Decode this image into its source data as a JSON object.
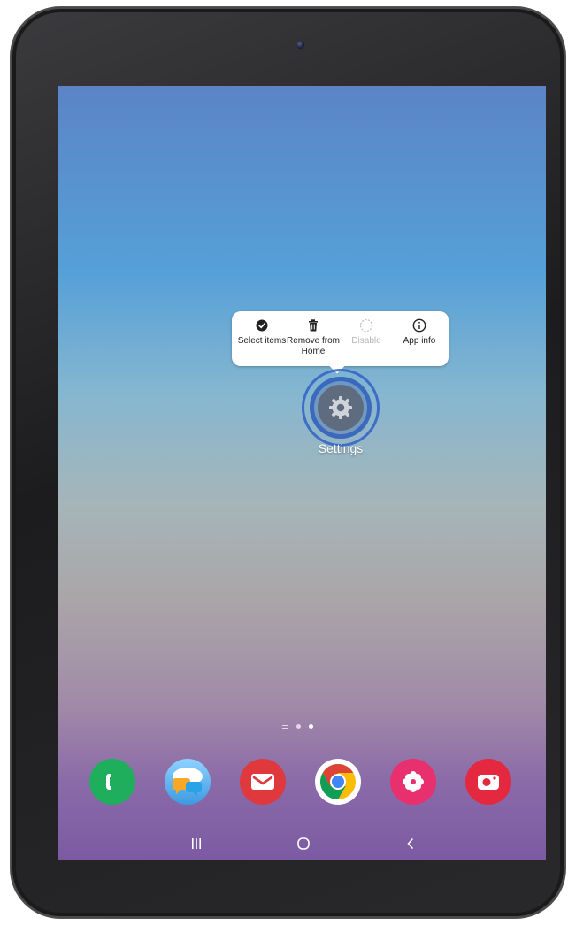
{
  "popup": {
    "items": [
      {
        "label": "Select items",
        "icon": "check-circle-icon",
        "enabled": true
      },
      {
        "label": "Remove from Home",
        "icon": "trash-icon",
        "enabled": true
      },
      {
        "label": "Disable",
        "icon": "disable-icon",
        "enabled": false
      },
      {
        "label": "App info",
        "icon": "info-icon",
        "enabled": true
      }
    ]
  },
  "app": {
    "label": "Settings",
    "icon": "gear-icon"
  },
  "page_indicator": {
    "pages": 3,
    "current": 3
  },
  "dock": [
    {
      "name": "Phone",
      "icon": "phone-icon",
      "color": "#1fae5b"
    },
    {
      "name": "Messages",
      "icon": "chat-bubbles-icon",
      "color": "#3d9ae0"
    },
    {
      "name": "Email",
      "icon": "envelope-icon",
      "color": "#e0393d"
    },
    {
      "name": "Chrome",
      "icon": "chrome-icon",
      "color": "#fbbc05"
    },
    {
      "name": "Gallery",
      "icon": "flower-icon",
      "color": "#e8306e"
    },
    {
      "name": "Camera",
      "icon": "camera-icon",
      "color": "#e3283f"
    }
  ],
  "navbar": [
    "recents-icon",
    "home-icon",
    "back-icon"
  ]
}
